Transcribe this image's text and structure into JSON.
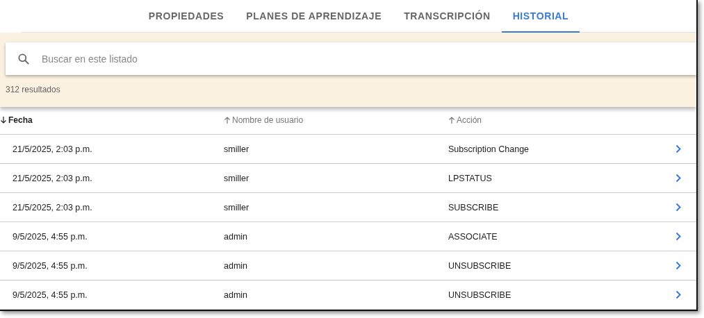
{
  "tabs": [
    {
      "label": "PROPIEDADES",
      "selected": false
    },
    {
      "label": "PLANES DE APRENDIZAJE",
      "selected": false
    },
    {
      "label": "TRANSCRIPCIÓN",
      "selected": false
    },
    {
      "label": "HISTORIAL",
      "selected": true
    }
  ],
  "search": {
    "placeholder": "Buscar en este listado"
  },
  "result_count": "312 resultados",
  "table": {
    "columns": [
      {
        "label": "Fecha",
        "descending": true,
        "active": true
      },
      {
        "label": "Nombre de usuario",
        "descending": false,
        "active": false
      },
      {
        "label": "Acción",
        "descending": false,
        "active": false
      }
    ],
    "rows": [
      {
        "cells": [
          "21/5/2025, 2:03 p.m.",
          "smiller",
          "Subscription Change"
        ]
      },
      {
        "cells": [
          "21/5/2025, 2:03 p.m.",
          "smiller",
          "LPSTATUS"
        ]
      },
      {
        "cells": [
          "21/5/2025, 2:03 p.m.",
          "smiller",
          "SUBSCRIBE"
        ]
      },
      {
        "cells": [
          "9/5/2025, 4:55 p.m.",
          "admin",
          "ASSOCIATE"
        ]
      },
      {
        "cells": [
          "9/5/2025, 4:55 p.m.",
          "admin",
          "UNSUBSCRIBE"
        ]
      },
      {
        "cells": [
          "9/5/2025, 4:55 p.m.",
          "admin",
          "UNSUBSCRIBE"
        ]
      }
    ]
  }
}
